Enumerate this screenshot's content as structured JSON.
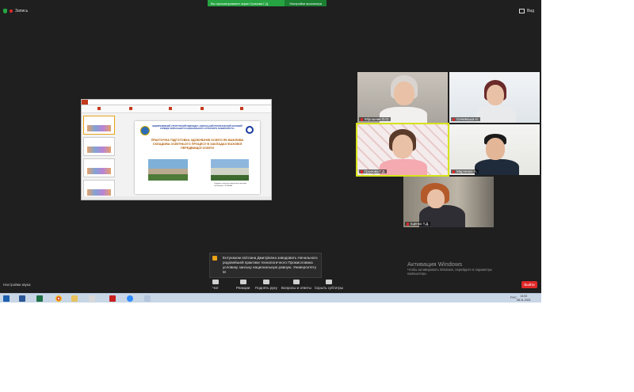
{
  "banner": {
    "viewing": "Вы просматриваете экран Громова Г.Д.",
    "options": "Настройки просмотра"
  },
  "recording": {
    "label": "Запись"
  },
  "view": {
    "label": "Вид"
  },
  "slide": {
    "header": "ВІДОКРЕМЛЕНИЙ СТРУКТУРНИЙ ПІДРОЗДІЛ «ЧЕРКАСЬКИЙ ПОЛІТЕХНІЧНИЙ ФАХОВИЙ КОЛЕДЖ ЧЕРКАСЬКОГО НАЦІОНАЛЬНОГО АГРАРНОГО УНІВЕРСИТЕТУ»",
    "title": "ПРАКТИЧНА ПІДГОТОВКА ЗДОБУВАЧІВ ОСВІТИ ЯК ВАЖЛИВА СКЛАДОВА ОСВІТНЬОГО ПРОЦЕСУ В ЗАКЛАДАХ ФАХОВОЇ ПЕРЕДВИЩОЇ ОСВІТИ",
    "caption": "Завідувач навчально-виробничої практики Г.Д.Громова, ГРОМОВА"
  },
  "participants": [
    {
      "name": "Мірошник О.О."
    },
    {
      "name": "Сичевська Н."
    },
    {
      "name": "Громова Г.Д."
    },
    {
      "name": "Марченко А."
    },
    {
      "name": "Іщенко Т.Д."
    }
  ],
  "chat_popup": {
    "message": "Ентуназом світлана Дмитрієвна заводовать Начального родовейшей практики технологичного Промисловика условику занську национальную равную. Университету М"
  },
  "activation": {
    "title": "Активация Windows",
    "text": "Чтобы активировать Windows, перейдите в параметры компьютера."
  },
  "toolbar": {
    "audio_settings": "Настройки звука",
    "chat": "Чат",
    "reactions": "Реакции",
    "raise_hand": "Поднять руку",
    "qa": "Вопросы и ответы",
    "captions": "Скрыть субтитры",
    "exit": "Выйти"
  },
  "taskbar": {
    "lang": "РУС",
    "time": "14:02",
    "date": "08.11.2021"
  }
}
